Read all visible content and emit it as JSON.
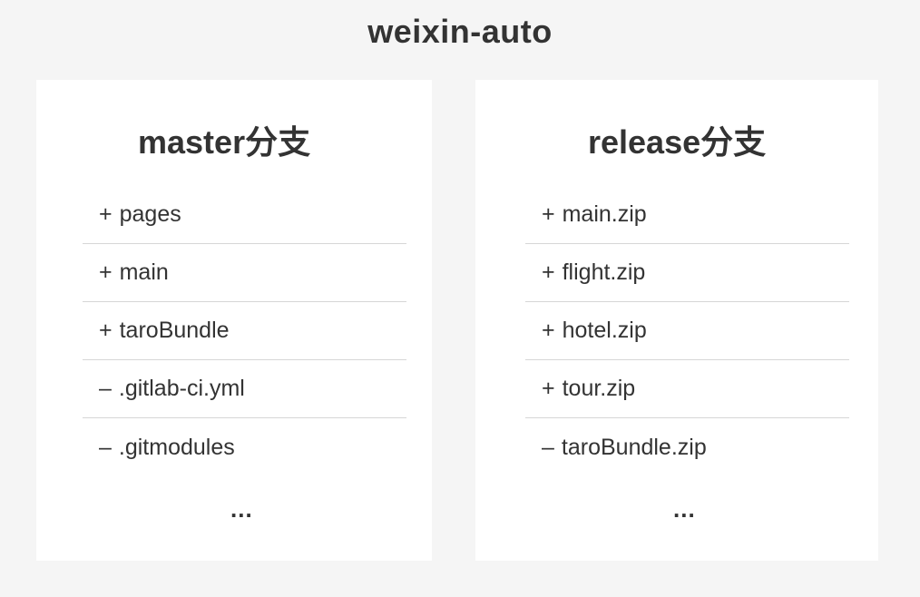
{
  "title": "weixin-auto",
  "panels": [
    {
      "title": "master分支",
      "items": [
        {
          "marker": "+",
          "name": "pages"
        },
        {
          "marker": "+",
          "name": "main"
        },
        {
          "marker": "+",
          "name": "taroBundle"
        },
        {
          "marker": "–",
          "name": ".gitlab-ci.yml"
        },
        {
          "marker": "–",
          "name": ".gitmodules"
        }
      ],
      "more": "..."
    },
    {
      "title": "release分支",
      "items": [
        {
          "marker": "+",
          "name": "main.zip"
        },
        {
          "marker": "+",
          "name": "flight.zip"
        },
        {
          "marker": "+",
          "name": "hotel.zip"
        },
        {
          "marker": "+",
          "name": "tour.zip"
        },
        {
          "marker": "–",
          "name": "taroBundle.zip"
        }
      ],
      "more": "..."
    }
  ]
}
